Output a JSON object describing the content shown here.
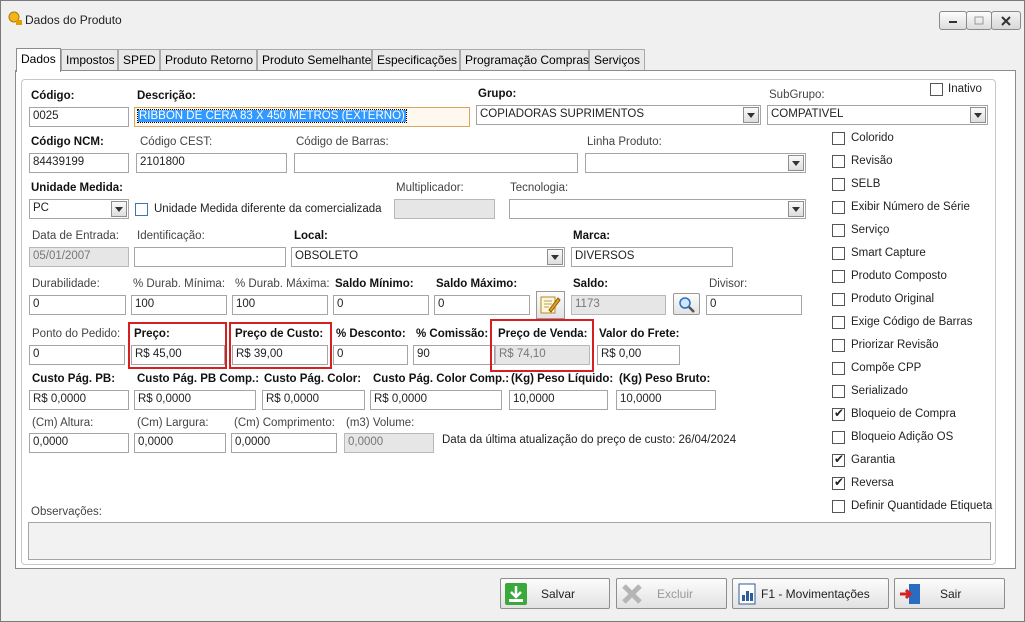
{
  "window": {
    "title": "Dados do Produto"
  },
  "tabs": [
    "Dados",
    "Impostos",
    "SPED",
    "Produto Retorno",
    "Produto Semelhante",
    "Especificações",
    "Programação Compras",
    "Serviços"
  ],
  "row1": {
    "codigo_label": "Código:",
    "codigo_value": "0025",
    "descricao_label": "Descrição:",
    "descricao_value": "RIBBON DE CERA 83 X 450 METROS (EXTERNO)",
    "grupo_label": "Grupo:",
    "grupo_value": "COPIADORAS SUPRIMENTOS",
    "subgrupo_label": "SubGrupo:",
    "subgrupo_value": "COMPATIVEL",
    "inativo_label": "Inativo"
  },
  "row2": {
    "ncm_label": "Código NCM:",
    "ncm_value": "84439199",
    "cest_label": "Código CEST:",
    "cest_value": "2101800",
    "barras_label": "Código de Barras:",
    "barras_value": "",
    "linha_label": "Linha Produto:",
    "linha_value": ""
  },
  "row3": {
    "unidade_label": "Unidade Medida:",
    "unidade_value": "PC",
    "unidade_diff_label": "Unidade Medida diferente da comercializada",
    "multiplicador_label": "Multiplicador:",
    "multiplicador_value": "",
    "tecnologia_label": "Tecnologia:",
    "tecnologia_value": ""
  },
  "row4": {
    "entrada_label": "Data de Entrada:",
    "entrada_value": "05/01/2007",
    "identificacao_label": "Identificação:",
    "identificacao_value": "",
    "local_label": "Local:",
    "local_value": "OBSOLETO",
    "marca_label": "Marca:",
    "marca_value": "DIVERSOS"
  },
  "row5": {
    "durab_label": "Durabilidade:",
    "durab_value": "0",
    "durab_min_label": "% Durab. Mínima:",
    "durab_min_value": "100",
    "durab_max_label": "% Durab. Máxima:",
    "durab_max_value": "100",
    "saldo_min_label": "Saldo Mínimo:",
    "saldo_min_value": "0",
    "saldo_max_label": "Saldo Máximo:",
    "saldo_max_value": "0",
    "saldo_label": "Saldo:",
    "saldo_value": "1173",
    "divisor_label": "Divisor:",
    "divisor_value": "0"
  },
  "row6": {
    "ponto_label": "Ponto do Pedido:",
    "ponto_value": "0",
    "preco_label": "Preço:",
    "preco_value": "R$ 45,00",
    "custo_label": "Preço de Custo:",
    "custo_value": "R$ 39,00",
    "desconto_label": "% Desconto:",
    "desconto_value": "0",
    "comissao_label": "% Comissão:",
    "comissao_value": "90",
    "venda_label": "Preço de Venda:",
    "venda_value": "R$ 74,10",
    "frete_label": "Valor do Frete:",
    "frete_value": "R$ 0,00"
  },
  "row7": {
    "pb_label": "Custo Pág. PB:",
    "pb_value": "R$ 0,0000",
    "pb_comp_label": "Custo Pág. PB Comp.:",
    "pb_comp_value": "R$ 0,0000",
    "color_label": "Custo Pág. Color:",
    "color_value": "R$ 0,0000",
    "color_comp_label": "Custo Pág. Color Comp.:",
    "color_comp_value": "R$ 0,0000",
    "peso_liq_label": "(Kg) Peso Líquido:",
    "peso_liq_value": "10,0000",
    "peso_bruto_label": "(Kg) Peso Bruto:",
    "peso_bruto_value": "10,0000"
  },
  "row8": {
    "altura_label": "(Cm) Altura:",
    "altura_value": "0,0000",
    "largura_label": "(Cm) Largura:",
    "largura_value": "0,0000",
    "comprimento_label": "(Cm) Comprimento:",
    "comprimento_value": "0,0000",
    "volume_label": "(m3) Volume:",
    "volume_value": "0,0000",
    "ultima_atualizacao": "Data da última atualização do preço de custo: 26/04/2024"
  },
  "observacoes_label": "Observações:",
  "flags": [
    {
      "label": "Colorido",
      "checked": false
    },
    {
      "label": "Revisão",
      "checked": false
    },
    {
      "label": "SELB",
      "checked": false
    },
    {
      "label": "Exibir Número de Série",
      "checked": false
    },
    {
      "label": "Serviço",
      "checked": false
    },
    {
      "label": "Smart Capture",
      "checked": false
    },
    {
      "label": "Produto Composto",
      "checked": false
    },
    {
      "label": "Produto Original",
      "checked": false
    },
    {
      "label": "Exige Código de Barras",
      "checked": false
    },
    {
      "label": "Priorizar Revisão",
      "checked": false
    },
    {
      "label": "Compõe CPP",
      "checked": false
    },
    {
      "label": "Serializado",
      "checked": false
    },
    {
      "label": "Bloqueio de Compra",
      "checked": true
    },
    {
      "label": "Bloqueio Adição OS",
      "checked": false
    },
    {
      "label": "Garantia",
      "checked": true
    },
    {
      "label": "Reversa",
      "checked": true
    },
    {
      "label": "Definir Quantidade Etiqueta",
      "checked": false
    }
  ],
  "buttons": {
    "salvar": "Salvar",
    "excluir": "Excluir",
    "movimentacoes": "F1 - Movimentações",
    "sair": "Sair"
  },
  "colors": {
    "highlight_box": "#d42020",
    "selection": "#3399ff"
  }
}
